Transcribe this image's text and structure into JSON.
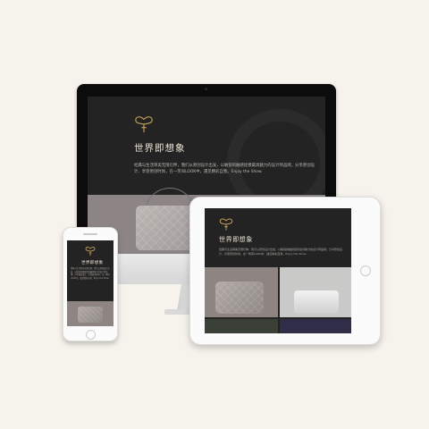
{
  "site": {
    "title": "世界即想象",
    "paragraph": "经典与生活审美无限衍伸，我们从原创设计出发，以敏锐的触感捉摸最具魅力的设计师品牌。分享原创设计、享受原创时尚，在一笑间LOOK中，遇见精彩自我。Enjoy the Show."
  },
  "colors": {
    "background": "#f6f2ec",
    "screen_dark": "#232323",
    "title_text": "#e9e3d4",
    "logo_gold": "#c8a45a"
  },
  "icons": {
    "logo": "butterfly-logo-icon"
  }
}
